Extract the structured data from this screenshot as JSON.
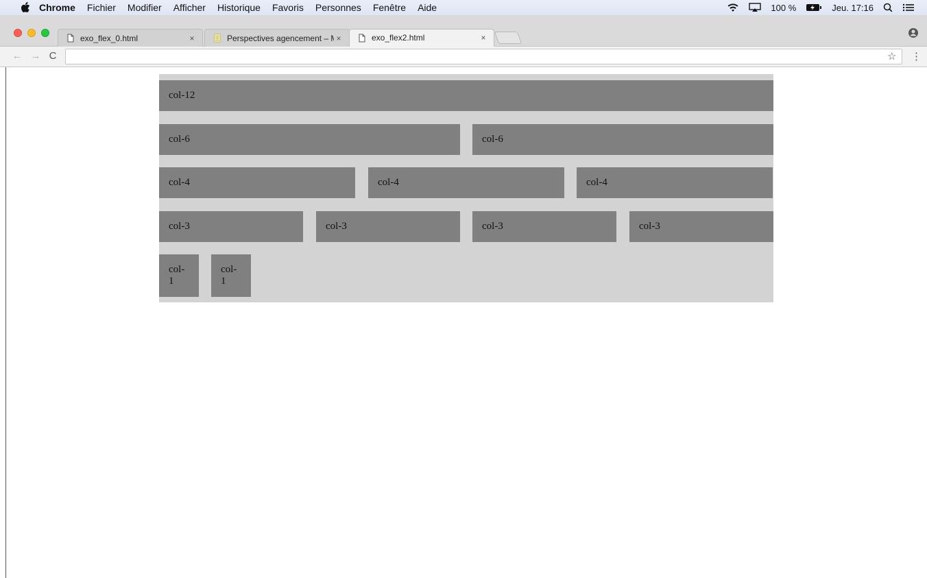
{
  "menubar": {
    "app": "Chrome",
    "items": [
      "Fichier",
      "Modifier",
      "Afficher",
      "Historique",
      "Favoris",
      "Personnes",
      "Fenêtre",
      "Aide"
    ],
    "battery": "100 %",
    "clock": "Jeu. 17:16"
  },
  "tabs": [
    {
      "title": "exo_flex_0.html",
      "close": "×",
      "active": false
    },
    {
      "title": "Perspectives agencement – M",
      "close": "×",
      "active": false
    },
    {
      "title": "exo_flex2.html",
      "close": "×",
      "active": true
    }
  ],
  "toolbar": {
    "url": ""
  },
  "grid": {
    "row12": [
      "col-12"
    ],
    "row6": [
      "col-6",
      "col-6"
    ],
    "row4": [
      "col-4",
      "col-4",
      "col-4"
    ],
    "row3": [
      "col-3",
      "col-3",
      "col-3",
      "col-3"
    ],
    "row1": [
      "col-\n1",
      "col-\n1"
    ]
  }
}
